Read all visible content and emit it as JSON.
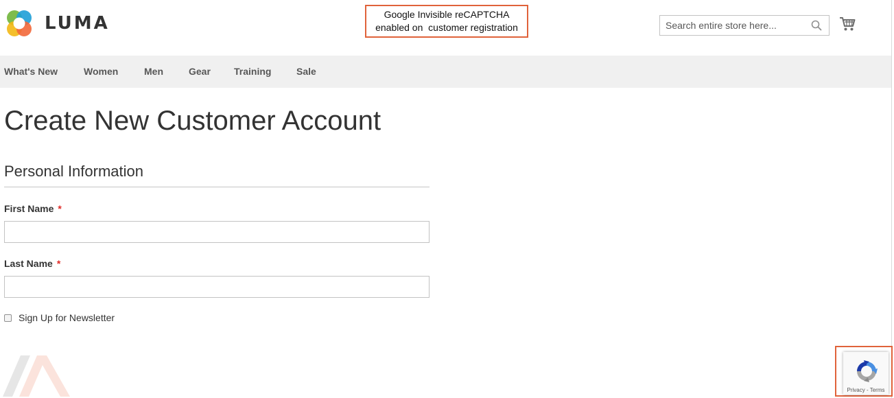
{
  "header": {
    "brand": "LUMA",
    "search_placeholder": "Search entire store here...",
    "callout_line1": "Google Invisible reCAPTCHA",
    "callout_line2": "enabled on  customer registration"
  },
  "nav": {
    "items": [
      "What's New",
      "Women",
      "Men",
      "Gear",
      "Training",
      "Sale"
    ]
  },
  "main": {
    "title": "Create New Customer Account",
    "section_title": "Personal Information",
    "first_name_label": "First Name",
    "last_name_label": "Last Name",
    "required_mark": "*",
    "newsletter_label": "Sign Up for Newsletter",
    "first_name_value": "",
    "last_name_value": ""
  },
  "recaptcha": {
    "privacy": "Privacy",
    "separator": "-",
    "terms": "Terms"
  },
  "colors": {
    "accent_callout": "#e0623a",
    "nav_bg": "#f0f0f0",
    "required": "#e02b27"
  },
  "icons": [
    "luma-logo-icon",
    "search-icon",
    "cart-icon",
    "recaptcha-icon",
    "watermark-logo-icon"
  ]
}
